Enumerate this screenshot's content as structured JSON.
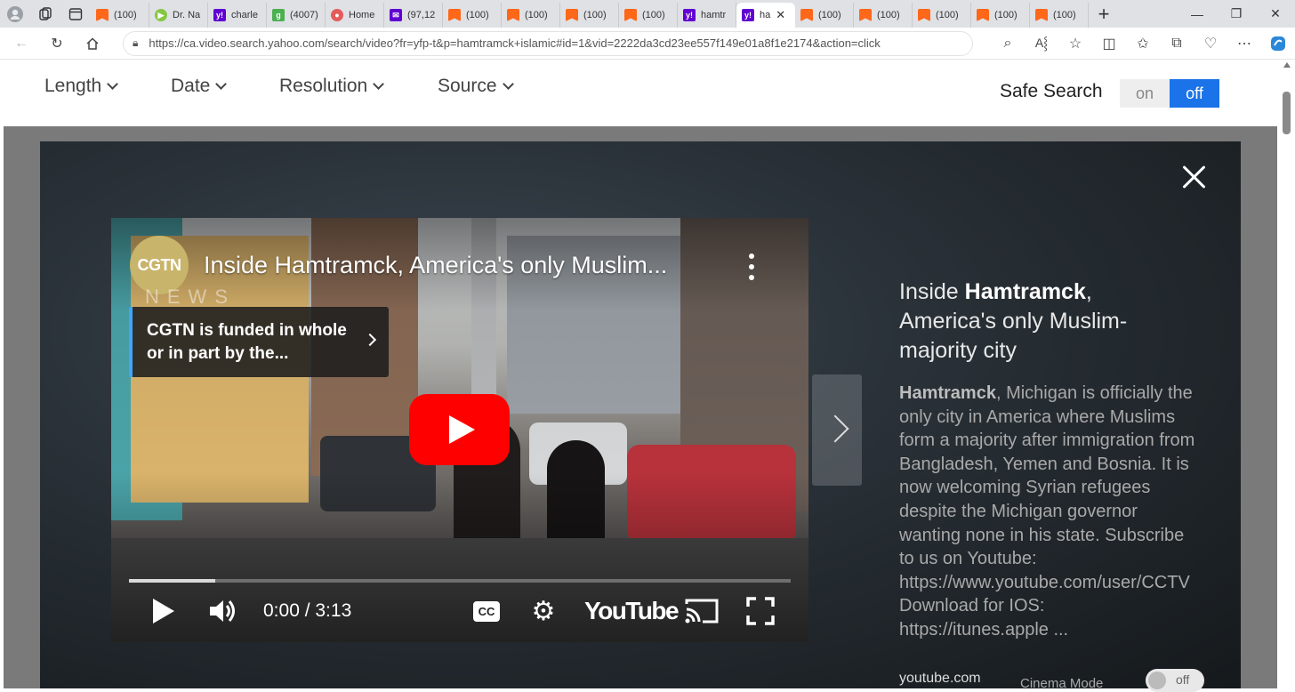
{
  "browser": {
    "tabs": [
      {
        "title": "(100)",
        "icon": "substack-icon"
      },
      {
        "title": "Dr. Na",
        "icon": "rumble-icon"
      },
      {
        "title": "charle",
        "icon": "yahoo-icon"
      },
      {
        "title": "(4007)",
        "icon": "green-icon"
      },
      {
        "title": "Home",
        "icon": "red-circle-icon"
      },
      {
        "title": "(97,12",
        "icon": "mail-icon"
      },
      {
        "title": "(100)",
        "icon": "substack-icon"
      },
      {
        "title": "(100)",
        "icon": "substack-icon"
      },
      {
        "title": "(100)",
        "icon": "substack-icon"
      },
      {
        "title": "(100)",
        "icon": "substack-icon"
      },
      {
        "title": "hamtr",
        "icon": "yahoo-icon"
      },
      {
        "title": "ha",
        "icon": "yahoo-icon",
        "active": true
      },
      {
        "title": "(100)",
        "icon": "substack-icon"
      },
      {
        "title": "(100)",
        "icon": "substack-icon"
      },
      {
        "title": "(100)",
        "icon": "substack-icon"
      },
      {
        "title": "(100)",
        "icon": "substack-icon"
      },
      {
        "title": "(100)",
        "icon": "substack-icon"
      }
    ],
    "url": "https://ca.video.search.yahoo.com/search/video?fr=yfp-t&p=hamtramck+islamic#id=1&vid=2222da3cd23ee557f149e01a8f1e2174&action=click"
  },
  "filters": {
    "length": "Length",
    "date": "Date",
    "resolution": "Resolution",
    "source": "Source"
  },
  "safe_search": {
    "label": "Safe Search",
    "on": "on",
    "off": "off",
    "selected": "off",
    "accent": "#1a73e8"
  },
  "video": {
    "channel_logo": "CGTN",
    "channel_sub": "NEWS",
    "title": "Inside Hamtramck, America's only Muslim...",
    "funding_notice": "CGTN is funded in whole or in part by the...",
    "time": "0:00 / 3:13",
    "progress_fraction": 0.13,
    "youtube_logo": "YouTube",
    "play_color": "#ff0000"
  },
  "description": {
    "title_pre": "Inside ",
    "title_bold": "Hamtramck",
    "title_post": ", America's only Muslim-majority city",
    "body_bold": "Hamtramck",
    "body": ", Michigan is officially the only city in America where Muslims form a majority after immigration from Bangladesh, Yemen and Bosnia. It is now welcoming Syrian refugees despite the Michigan governor wanting none in his state. Subscribe to us on Youtube:\nhttps://www.youtube.com/user/CCTV\nDownload for IOS:\nhttps://itunes.apple ...",
    "source": "youtube.com",
    "cinema_mode": "Cinema Mode",
    "cinema_state": "off"
  }
}
